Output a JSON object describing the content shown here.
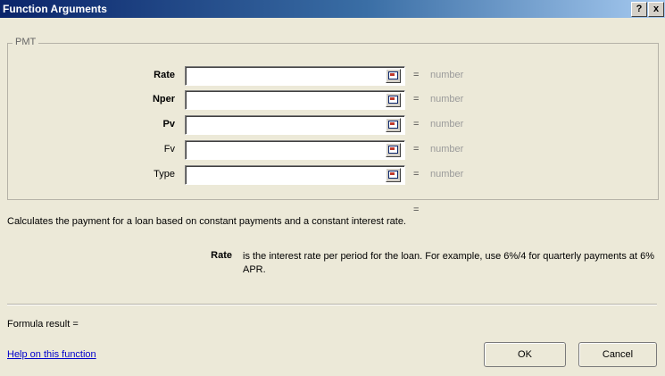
{
  "window": {
    "title": "Function Arguments",
    "help_button": "?",
    "close_button": "x"
  },
  "group": {
    "legend": "PMT"
  },
  "arguments": [
    {
      "label": "Rate",
      "value": "",
      "result": "number",
      "eq": "="
    },
    {
      "label": "Nper",
      "value": "",
      "result": "number",
      "eq": "="
    },
    {
      "label": "Pv",
      "value": "",
      "result": "number",
      "eq": "="
    },
    {
      "label": "Fv",
      "value": "",
      "result": "number",
      "eq": "="
    },
    {
      "label": "Type",
      "value": "",
      "result": "number",
      "eq": "="
    }
  ],
  "result_eq": "=",
  "description": "Calculates the payment for a loan based on constant payments and a constant interest rate.",
  "arg_help": {
    "name": "Rate",
    "text": "is the interest rate per period for the loan. For example, use 6%/4 for quarterly payments at 6% APR."
  },
  "formula_result": "Formula result =",
  "help_link": "Help on this function",
  "buttons": {
    "ok": "OK",
    "cancel": "Cancel"
  }
}
